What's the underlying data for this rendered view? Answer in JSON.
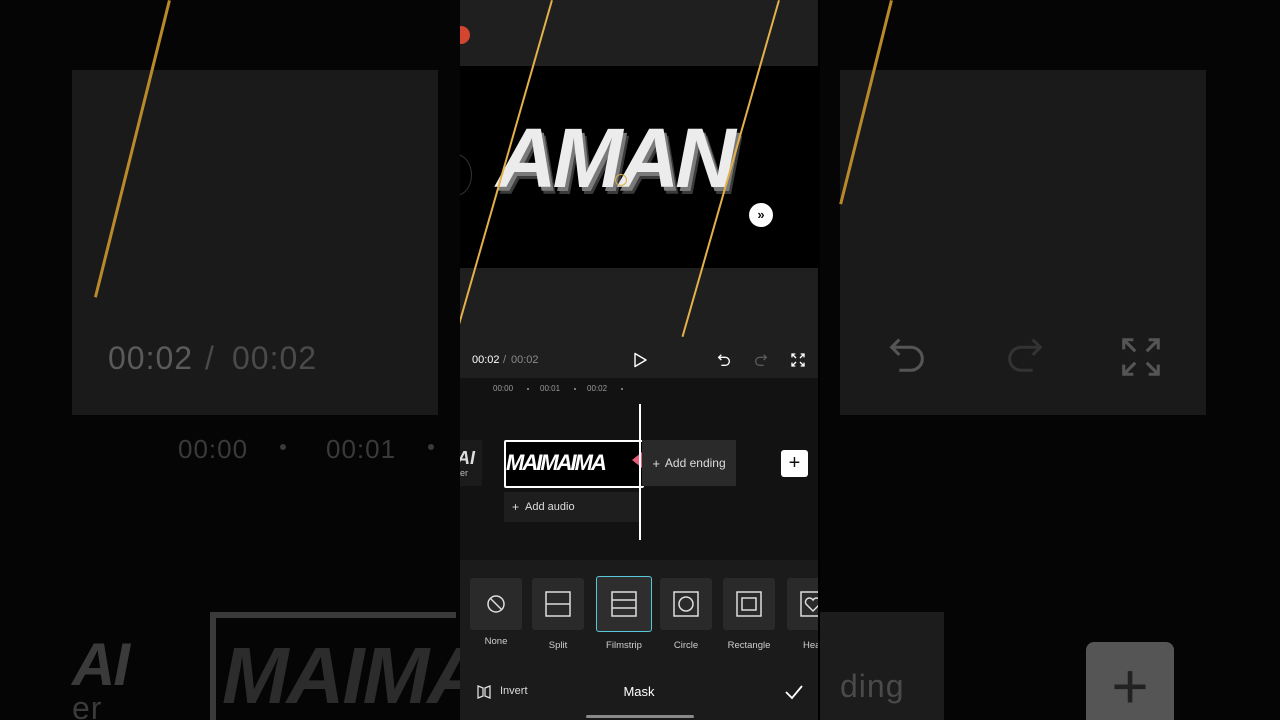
{
  "preview": {
    "title_text": "AMAN"
  },
  "transport": {
    "current_time": "00:02",
    "separator": "/",
    "total_time": "00:02"
  },
  "timeline": {
    "ruler": [
      "00:00",
      "00:01",
      "00:02"
    ],
    "cover_text": "AI",
    "cover_sub": "er",
    "clip_text": "MAIMAIMA",
    "add_ending_label": "Add ending",
    "add_audio_label": "Add audio",
    "add_clip_symbol": "+"
  },
  "mask": {
    "options": [
      {
        "label": "None",
        "icon": "none-icon"
      },
      {
        "label": "Split",
        "icon": "split-icon"
      },
      {
        "label": "Filmstrip",
        "icon": "filmstrip-icon",
        "selected": true
      },
      {
        "label": "Circle",
        "icon": "circle-icon"
      },
      {
        "label": "Rectangle",
        "icon": "rectangle-icon"
      },
      {
        "label": "Hea",
        "icon": "heart-icon"
      }
    ],
    "invert_label": "Invert",
    "title": "Mask"
  },
  "background": {
    "time_current": "00:02",
    "time_separator": "/",
    "time_total": "00:02",
    "ruler_0": "00:00",
    "ruler_1": "00:01",
    "big_left": "MAIMA",
    "ending_fragment": "ding",
    "cover_fragment": "AI",
    "cover_sub": "er"
  },
  "colors": {
    "accent_selected": "#56c8d8",
    "guide_line": "#e3b04b",
    "clip_handle": "#e85d7a"
  }
}
